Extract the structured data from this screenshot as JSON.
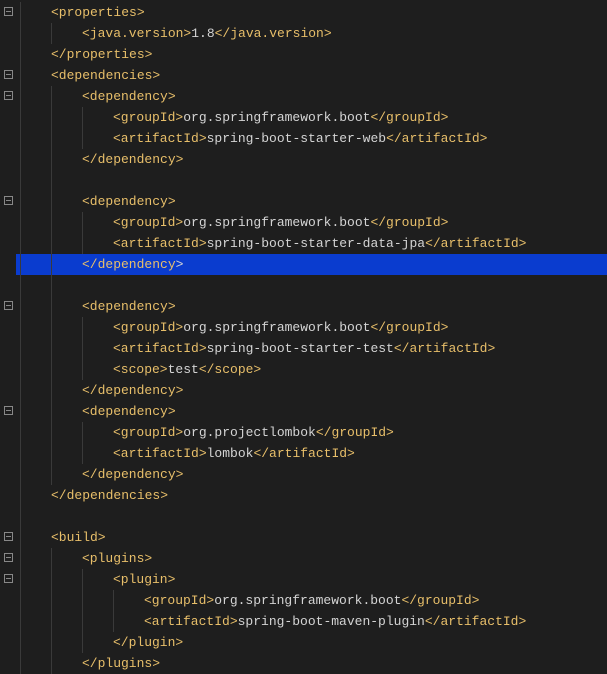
{
  "code": {
    "lines": [
      {
        "indent": 1,
        "segments": [
          {
            "t": "tag",
            "v": "<properties>"
          }
        ],
        "highlighted": false
      },
      {
        "indent": 2,
        "segments": [
          {
            "t": "tag",
            "v": "<java.version>"
          },
          {
            "t": "text",
            "v": "1.8"
          },
          {
            "t": "tag",
            "v": "</java.version>"
          }
        ],
        "highlighted": false
      },
      {
        "indent": 1,
        "segments": [
          {
            "t": "tag",
            "v": "</properties>"
          }
        ],
        "highlighted": false
      },
      {
        "indent": 1,
        "segments": [
          {
            "t": "tag",
            "v": "<dependencies>"
          }
        ],
        "highlighted": false
      },
      {
        "indent": 2,
        "segments": [
          {
            "t": "tag",
            "v": "<dependency>"
          }
        ],
        "highlighted": false
      },
      {
        "indent": 3,
        "segments": [
          {
            "t": "tag",
            "v": "<groupId>"
          },
          {
            "t": "text",
            "v": "org.springframework.boot"
          },
          {
            "t": "tag",
            "v": "</groupId>"
          }
        ],
        "highlighted": false
      },
      {
        "indent": 3,
        "segments": [
          {
            "t": "tag",
            "v": "<artifactId>"
          },
          {
            "t": "text",
            "v": "spring-boot-starter-web"
          },
          {
            "t": "tag",
            "v": "</artifactId>"
          }
        ],
        "highlighted": false
      },
      {
        "indent": 2,
        "segments": [
          {
            "t": "tag",
            "v": "</dependency>"
          }
        ],
        "highlighted": false
      },
      {
        "indent": 2,
        "segments": [],
        "highlighted": false
      },
      {
        "indent": 2,
        "segments": [
          {
            "t": "tag",
            "v": "<dependency>"
          }
        ],
        "highlighted": false
      },
      {
        "indent": 3,
        "segments": [
          {
            "t": "tag",
            "v": "<groupId>"
          },
          {
            "t": "text",
            "v": "org.springframework.boot"
          },
          {
            "t": "tag",
            "v": "</groupId>"
          }
        ],
        "highlighted": false
      },
      {
        "indent": 3,
        "segments": [
          {
            "t": "tag",
            "v": "<artifactId>"
          },
          {
            "t": "text",
            "v": "spring-boot-starter-data-jpa"
          },
          {
            "t": "tag",
            "v": "</artifactId>"
          }
        ],
        "highlighted": false
      },
      {
        "indent": 2,
        "segments": [
          {
            "t": "tag",
            "v": "</dependency"
          },
          {
            "t": "text",
            "v": ">"
          }
        ],
        "highlighted": true
      },
      {
        "indent": 2,
        "segments": [],
        "highlighted": false
      },
      {
        "indent": 2,
        "segments": [
          {
            "t": "tag",
            "v": "<dependency>"
          }
        ],
        "highlighted": false
      },
      {
        "indent": 3,
        "segments": [
          {
            "t": "tag",
            "v": "<groupId>"
          },
          {
            "t": "text",
            "v": "org.springframework.boot"
          },
          {
            "t": "tag",
            "v": "</groupId>"
          }
        ],
        "highlighted": false
      },
      {
        "indent": 3,
        "segments": [
          {
            "t": "tag",
            "v": "<artifactId>"
          },
          {
            "t": "text",
            "v": "spring-boot-starter-test"
          },
          {
            "t": "tag",
            "v": "</artifactId>"
          }
        ],
        "highlighted": false
      },
      {
        "indent": 3,
        "segments": [
          {
            "t": "tag",
            "v": "<scope>"
          },
          {
            "t": "text",
            "v": "test"
          },
          {
            "t": "tag",
            "v": "</scope>"
          }
        ],
        "highlighted": false
      },
      {
        "indent": 2,
        "segments": [
          {
            "t": "tag",
            "v": "</dependency>"
          }
        ],
        "highlighted": false
      },
      {
        "indent": 2,
        "segments": [
          {
            "t": "tag",
            "v": "<dependency>"
          }
        ],
        "highlighted": false
      },
      {
        "indent": 3,
        "segments": [
          {
            "t": "tag",
            "v": "<groupId>"
          },
          {
            "t": "text",
            "v": "org.projectlombok"
          },
          {
            "t": "tag",
            "v": "</groupId>"
          }
        ],
        "highlighted": false
      },
      {
        "indent": 3,
        "segments": [
          {
            "t": "tag",
            "v": "<artifactId>"
          },
          {
            "t": "text",
            "v": "lombok"
          },
          {
            "t": "tag",
            "v": "</artifactId>"
          }
        ],
        "highlighted": false
      },
      {
        "indent": 2,
        "segments": [
          {
            "t": "tag",
            "v": "</dependency>"
          }
        ],
        "highlighted": false
      },
      {
        "indent": 1,
        "segments": [
          {
            "t": "tag",
            "v": "</dependencies>"
          }
        ],
        "highlighted": false
      },
      {
        "indent": 1,
        "segments": [],
        "highlighted": false
      },
      {
        "indent": 1,
        "segments": [
          {
            "t": "tag",
            "v": "<build>"
          }
        ],
        "highlighted": false
      },
      {
        "indent": 2,
        "segments": [
          {
            "t": "tag",
            "v": "<plugins>"
          }
        ],
        "highlighted": false
      },
      {
        "indent": 3,
        "segments": [
          {
            "t": "tag",
            "v": "<plugin>"
          }
        ],
        "highlighted": false
      },
      {
        "indent": 4,
        "segments": [
          {
            "t": "tag",
            "v": "<groupId>"
          },
          {
            "t": "text",
            "v": "org.springframework.boot"
          },
          {
            "t": "tag",
            "v": "</groupId>"
          }
        ],
        "highlighted": false
      },
      {
        "indent": 4,
        "segments": [
          {
            "t": "tag",
            "v": "<artifactId>"
          },
          {
            "t": "text",
            "v": "spring-boot-maven-plugin"
          },
          {
            "t": "tag",
            "v": "</artifactId>"
          }
        ],
        "highlighted": false
      },
      {
        "indent": 3,
        "segments": [
          {
            "t": "tag",
            "v": "</plugin>"
          }
        ],
        "highlighted": false
      },
      {
        "indent": 2,
        "segments": [
          {
            "t": "tag",
            "v": "</plugins>"
          }
        ],
        "highlighted": false
      }
    ],
    "fold_markers_at": [
      0,
      3,
      4,
      9,
      14,
      19,
      25,
      26,
      27
    ]
  },
  "colors": {
    "background": "#1e1e1e",
    "tag": "#e8bf6a",
    "text": "#d4d4d4",
    "highlight": "#0a3ccf"
  }
}
